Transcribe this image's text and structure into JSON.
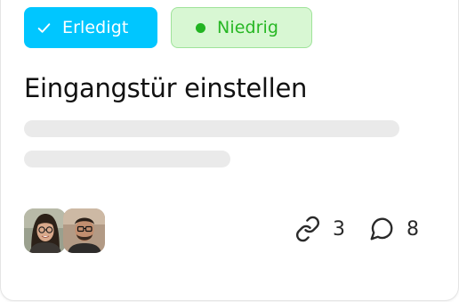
{
  "task": {
    "status_label": "Erledigt",
    "priority_label": "Niedrig",
    "title": "Eingangstür einstellen",
    "links_count": "3",
    "comments_count": "8"
  },
  "colors": {
    "status_bg": "#00c6ff",
    "priority_bg": "#d8f7d3",
    "priority_text": "#27b724"
  },
  "icons": {
    "status": "check-icon",
    "priority": "dot-icon",
    "links": "link-icon",
    "comments": "comment-icon"
  }
}
